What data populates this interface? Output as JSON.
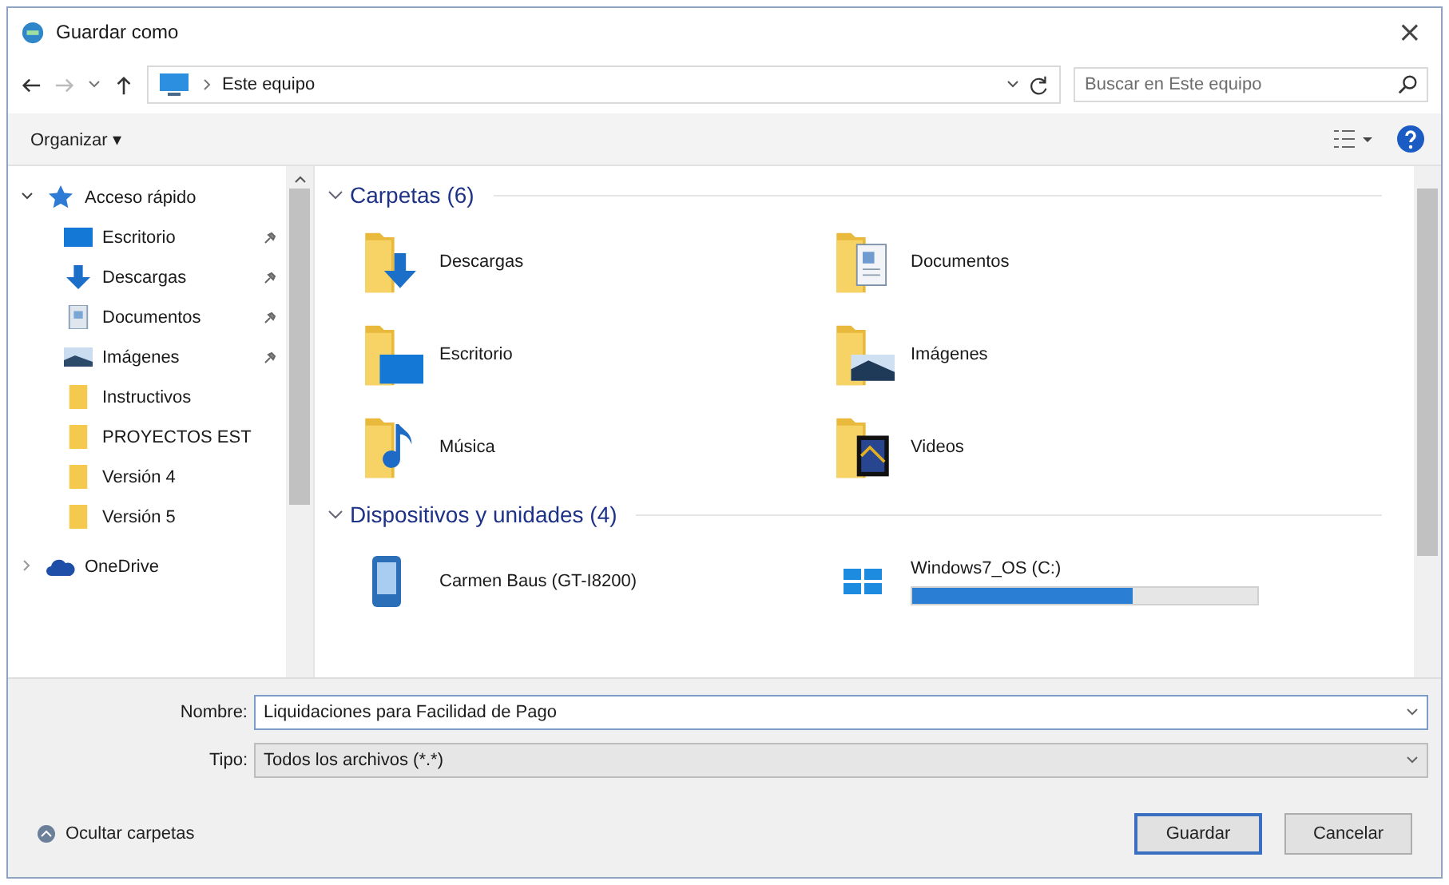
{
  "window": {
    "title": "Guardar como",
    "close": "×"
  },
  "address": {
    "path": "Este equipo",
    "search_placeholder": "Buscar en Este equipo"
  },
  "toolbar": {
    "organize": "Organizar ▾"
  },
  "sidebar": {
    "items": [
      {
        "label": "Acceso rápido",
        "kind": "star",
        "expanded": true,
        "children": [
          {
            "label": "Escritorio",
            "kind": "desktop",
            "pinned": true
          },
          {
            "label": "Descargas",
            "kind": "download",
            "pinned": true
          },
          {
            "label": "Documentos",
            "kind": "documents",
            "pinned": true
          },
          {
            "label": "Imágenes",
            "kind": "pictures",
            "pinned": true
          },
          {
            "label": "Instructivos",
            "kind": "folder",
            "pinned": false
          },
          {
            "label": "PROYECTOS EST",
            "kind": "folder",
            "pinned": false
          },
          {
            "label": "Versión 4",
            "kind": "folder",
            "pinned": false
          },
          {
            "label": "Versión 5",
            "kind": "folder",
            "pinned": false
          }
        ]
      },
      {
        "label": "OneDrive",
        "kind": "cloud",
        "expanded": false
      }
    ]
  },
  "groups": [
    {
      "title": "Carpetas (6)",
      "items": [
        {
          "label": "Descargas",
          "kind": "download"
        },
        {
          "label": "Documentos",
          "kind": "documents"
        },
        {
          "label": "Escritorio",
          "kind": "desktop"
        },
        {
          "label": "Imágenes",
          "kind": "pictures"
        },
        {
          "label": "Música",
          "kind": "music"
        },
        {
          "label": "Videos",
          "kind": "videos"
        }
      ]
    },
    {
      "title": "Dispositivos y unidades (4)",
      "items": [
        {
          "label": "Carmen Baus (GT-I8200)",
          "kind": "phone"
        },
        {
          "label": "Windows7_OS (C:)",
          "kind": "drive",
          "level": 0.64
        }
      ]
    }
  ],
  "form": {
    "name_label": "Nombre:",
    "name_value": "Liquidaciones para Facilidad de Pago",
    "type_label": "Tipo:",
    "type_value": "Todos los archivos (*.*)"
  },
  "footer": {
    "hide_folders": "Ocultar carpetas",
    "buttons": [
      {
        "label": "Guardar",
        "default": true
      },
      {
        "label": "Cancelar",
        "default": false
      }
    ]
  }
}
